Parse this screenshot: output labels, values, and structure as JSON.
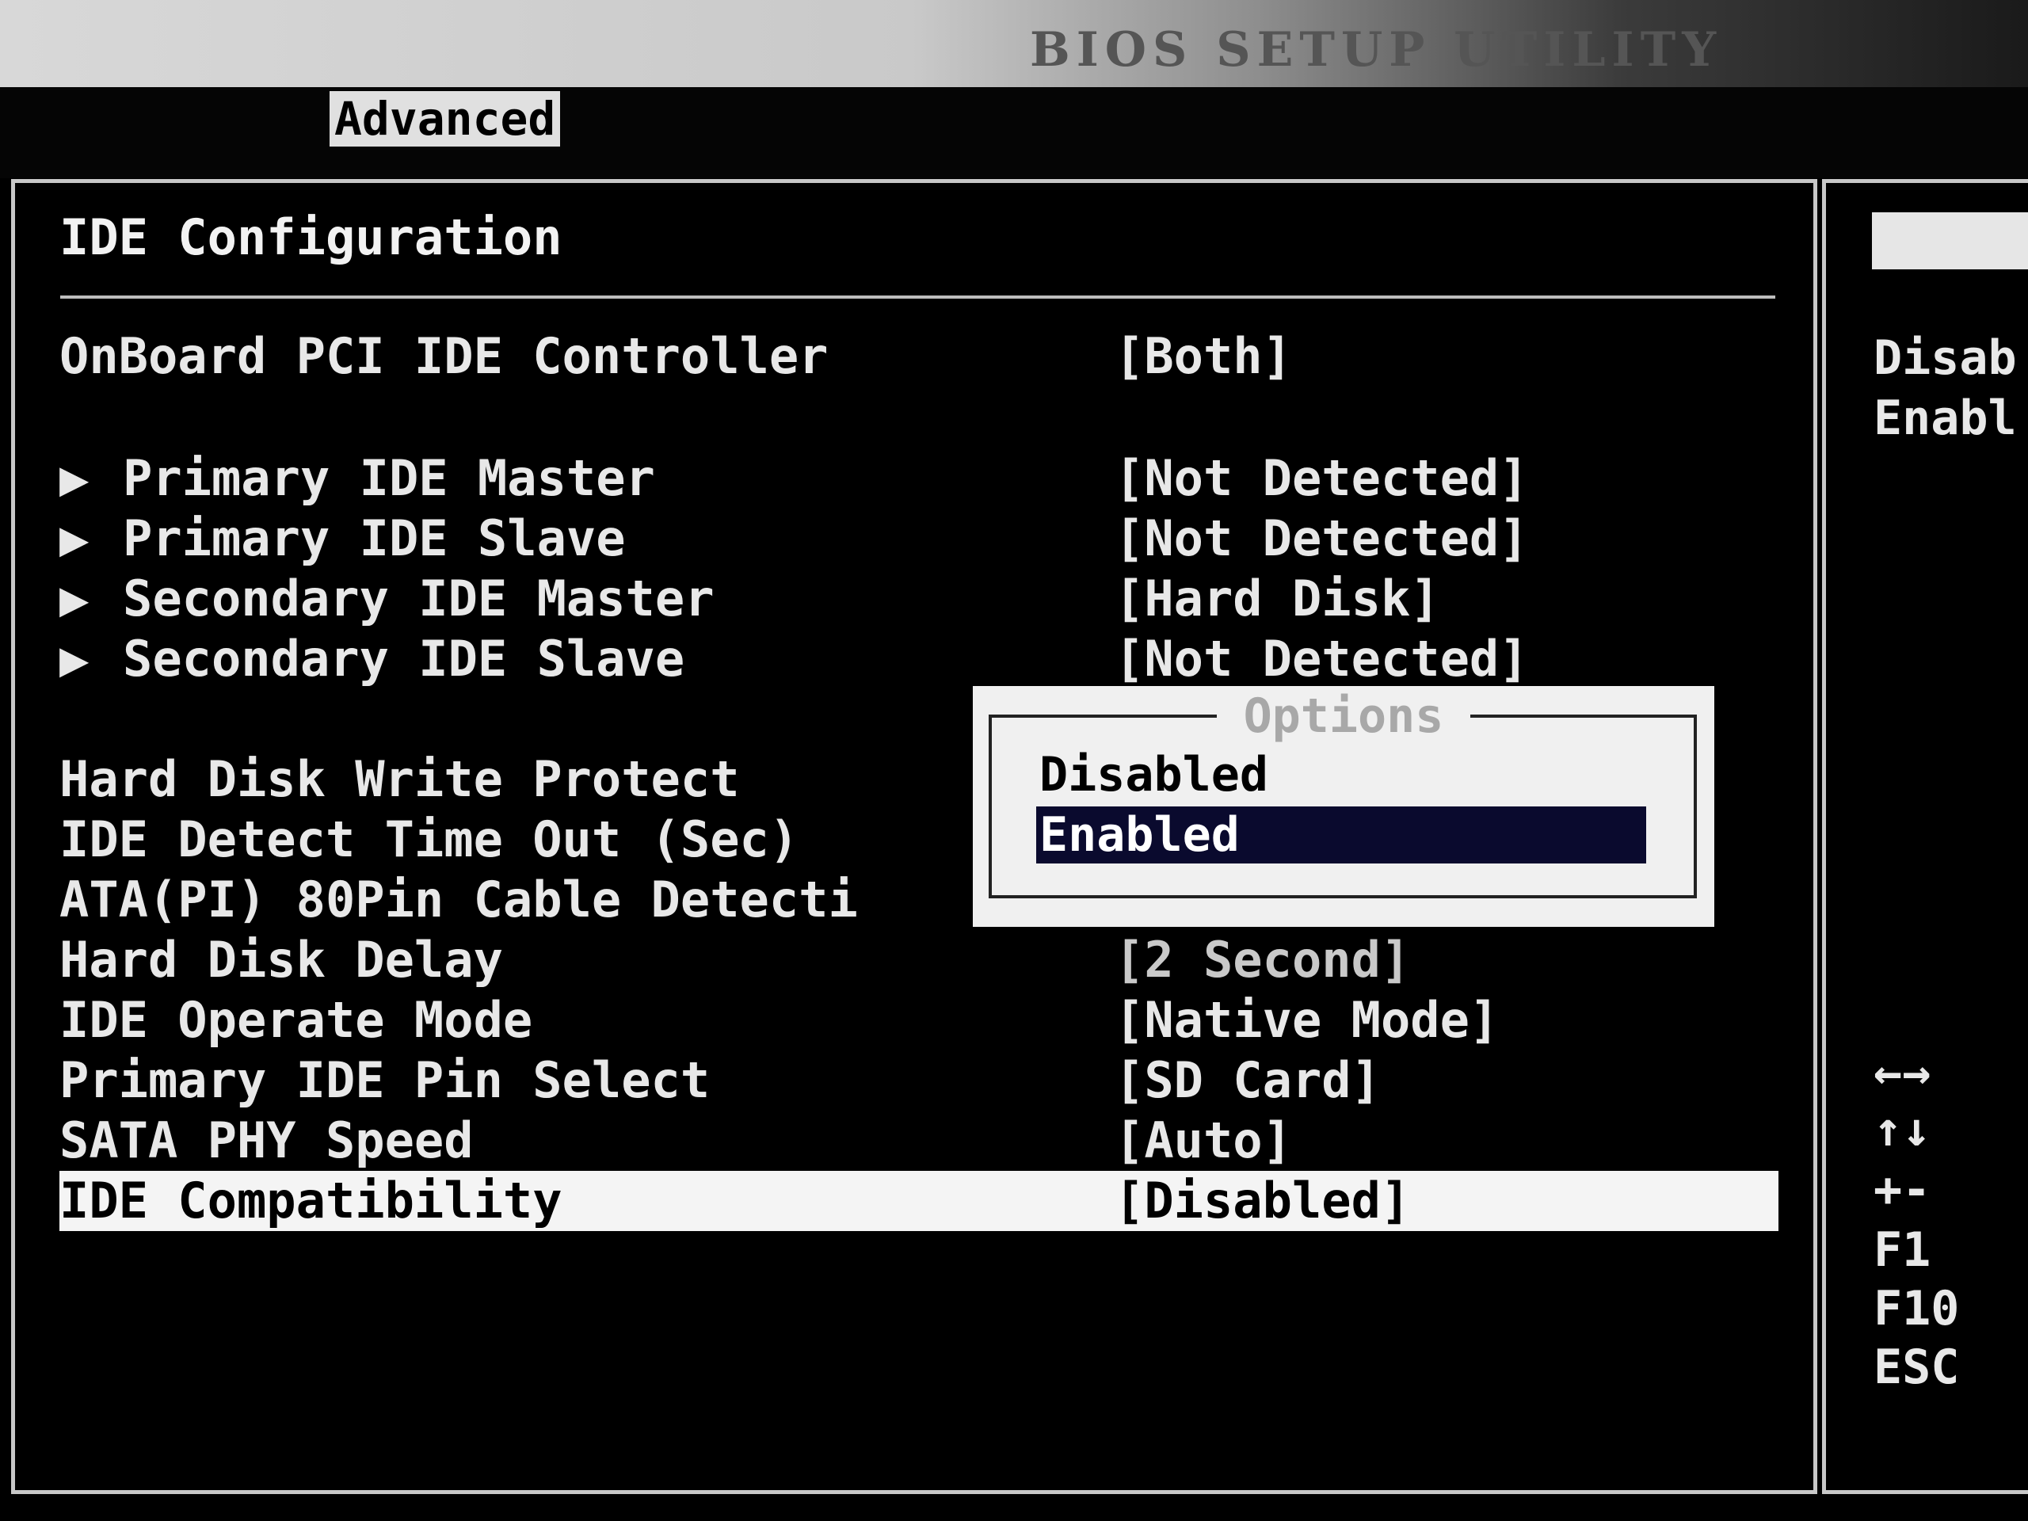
{
  "header": {
    "title": "BIOS SETUP UTILITY",
    "active_tab": "Advanced"
  },
  "section": {
    "title": "IDE Configuration"
  },
  "rows": [
    {
      "label": "OnBoard PCI IDE Controller",
      "value": "[Both]",
      "submenu": false
    },
    {
      "label": "Primary IDE Master",
      "value": "[Not Detected]",
      "submenu": true
    },
    {
      "label": "Primary IDE Slave",
      "value": "[Not Detected]",
      "submenu": true
    },
    {
      "label": "Secondary IDE Master",
      "value": "[Hard Disk]",
      "submenu": true
    },
    {
      "label": "Secondary IDE Slave",
      "value": "[Not Detected]",
      "submenu": true
    },
    {
      "label": "Hard Disk Write Protect",
      "value": "",
      "submenu": false
    },
    {
      "label": "IDE Detect Time Out (Sec)",
      "value": "",
      "submenu": false
    },
    {
      "label": "ATA(PI) 80Pin Cable Detecti",
      "value": "",
      "submenu": false
    },
    {
      "label": "Hard Disk Delay",
      "value": "[2 Second]",
      "submenu": false
    },
    {
      "label": "IDE Operate Mode",
      "value": "[Native Mode]",
      "submenu": false
    },
    {
      "label": "Primary IDE Pin Select",
      "value": "[SD Card]",
      "submenu": false
    },
    {
      "label": "SATA PHY Speed",
      "value": "[Auto]",
      "submenu": false
    },
    {
      "label": "IDE Compatibility",
      "value": "[Disabled]",
      "submenu": false,
      "selected": true
    }
  ],
  "submenu_marker": "▶",
  "popup": {
    "title": "Options",
    "options": [
      {
        "label": "Disabled",
        "highlighted": false
      },
      {
        "label": "Enabled",
        "highlighted": true
      }
    ]
  },
  "help": {
    "lines": [
      "Disab",
      "Enabl"
    ]
  },
  "keys": [
    "←→",
    "↑↓",
    "+-",
    "F1",
    "F10",
    "ESC"
  ]
}
